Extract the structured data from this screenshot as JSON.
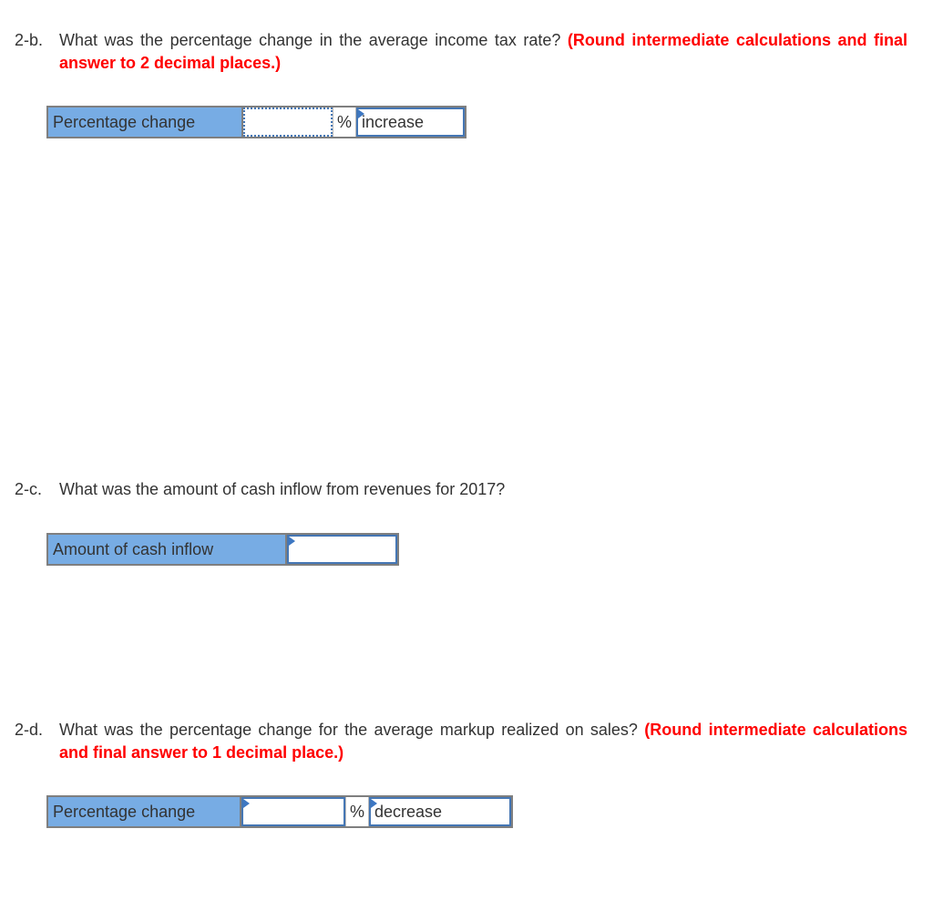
{
  "questions": [
    {
      "number": "2-b.",
      "text": "What was the percentage change in the average income tax rate?",
      "note": "(Round intermediate calculations and final answer to 2 decimal places.)",
      "row": {
        "label": "Percentage change",
        "input_value": "",
        "unit": "%",
        "direction": "increase"
      }
    },
    {
      "number": "2-c.",
      "text": "What was the amount of cash inflow from revenues for 2017?",
      "note": "",
      "row": {
        "label": "Amount of cash inflow",
        "input_value": ""
      }
    },
    {
      "number": "2-d.",
      "text": "What was the percentage change for the average markup realized on sales?",
      "note": "(Round intermediate calculations and final answer to 1 decimal place.)",
      "row": {
        "label": "Percentage change",
        "input_value": "",
        "unit": "%",
        "direction": "decrease"
      }
    }
  ],
  "colors": {
    "label_bg": "#77ace4",
    "note_red": "#ff0000",
    "input_border": "#4476b4"
  }
}
